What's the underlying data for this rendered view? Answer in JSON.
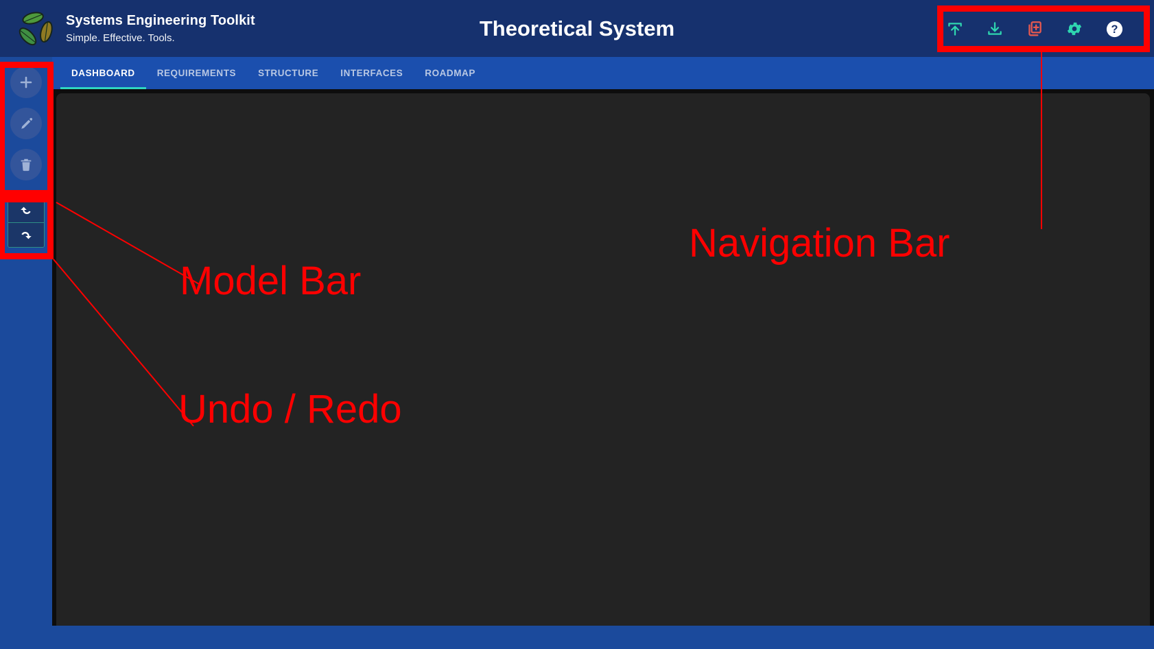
{
  "header": {
    "brand_title": "Systems Engineering Toolkit",
    "brand_subtitle": "Simple. Effective. Tools.",
    "app_title": "Theoretical System",
    "logo_icon": "three-leaves-recycle-logo",
    "background_color": "#16316e"
  },
  "navbar": {
    "items": [
      {
        "name": "upload-model-button",
        "icon": "upload-icon",
        "color": "#2fd6b0",
        "tooltip": "Upload"
      },
      {
        "name": "download-model-button",
        "icon": "download-icon",
        "color": "#2fd6b0",
        "tooltip": "Download"
      },
      {
        "name": "new-model-button",
        "icon": "new-document-icon",
        "color": "#e8594f",
        "tooltip": "New"
      },
      {
        "name": "settings-button",
        "icon": "gear-icon",
        "color": "#2fd6b0",
        "tooltip": "Settings"
      },
      {
        "name": "help-button",
        "icon": "help-circle-icon",
        "color": "#ffffff",
        "tooltip": "Help"
      }
    ]
  },
  "tabs": {
    "active": "DASHBOARD",
    "active_underline_color": "#2fd6c0",
    "items": [
      {
        "label": "DASHBOARD",
        "active": true
      },
      {
        "label": "REQUIREMENTS",
        "active": false
      },
      {
        "label": "STRUCTURE",
        "active": false
      },
      {
        "label": "INTERFACES",
        "active": false
      },
      {
        "label": "ROADMAP",
        "active": false
      }
    ]
  },
  "sidebar": {
    "background_color": "#1b4a9c",
    "model_bar": [
      {
        "name": "add-element-button",
        "icon": "plus-icon",
        "tooltip": "Add"
      },
      {
        "name": "edit-element-button",
        "icon": "pencil-icon",
        "tooltip": "Edit"
      },
      {
        "name": "delete-element-button",
        "icon": "trash-icon",
        "tooltip": "Delete"
      }
    ],
    "history_bar": [
      {
        "name": "undo-button",
        "icon": "undo-arrow-icon",
        "tooltip": "Undo"
      },
      {
        "name": "redo-button",
        "icon": "redo-arrow-icon",
        "tooltip": "Redo"
      }
    ]
  },
  "canvas": {
    "background_color": "#232323",
    "frame_color": "#0d0d0d"
  },
  "annotations": {
    "color": "#ff0000",
    "labels": [
      {
        "key": "navigation_bar",
        "text": "Navigation Bar"
      },
      {
        "key": "model_bar",
        "text": "Model Bar"
      },
      {
        "key": "undo_redo",
        "text": "Undo / Redo"
      }
    ],
    "navigation_bar_label": "Navigation Bar",
    "model_bar_label": "Model Bar",
    "undo_redo_label": "Undo / Redo"
  }
}
